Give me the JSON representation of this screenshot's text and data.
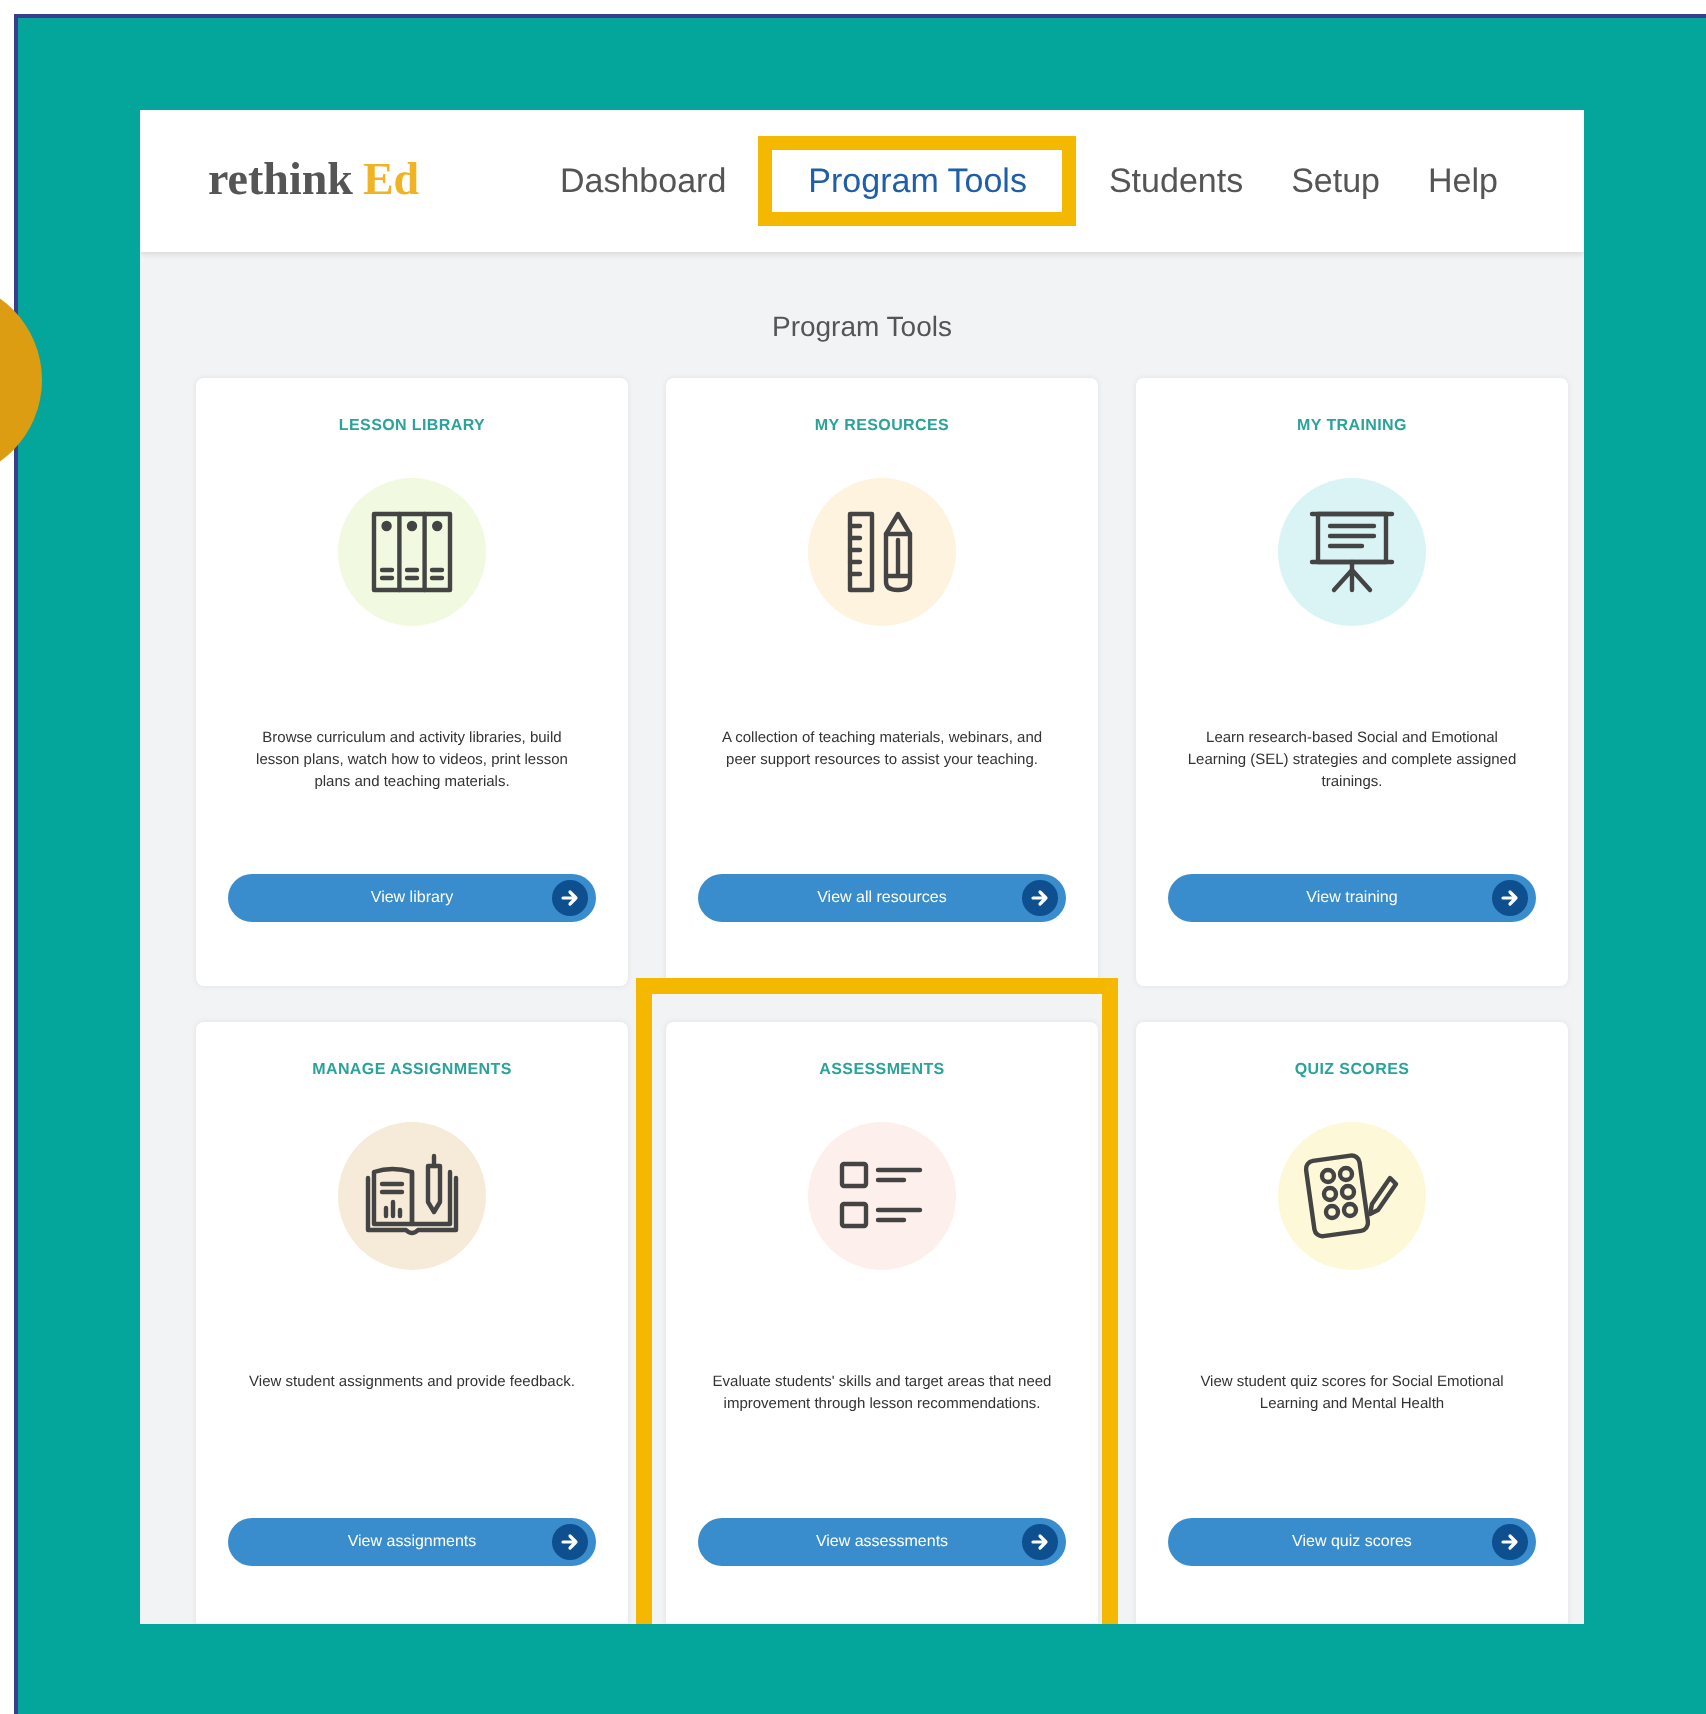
{
  "logo": {
    "part_1": "rethink",
    "part_2": "Ed"
  },
  "nav": [
    {
      "label": "Dashboard",
      "selected": false,
      "highlighted": false
    },
    {
      "label": "Program Tools",
      "selected": true,
      "highlighted": true
    },
    {
      "label": "Students",
      "selected": false,
      "highlighted": false
    },
    {
      "label": "Setup",
      "selected": false,
      "highlighted": false
    },
    {
      "label": "Help",
      "selected": false,
      "highlighted": false
    }
  ],
  "page_title": "Program Tools",
  "cards": [
    {
      "title": "LESSON LIBRARY",
      "color": "#f1f9e1",
      "description": "Browse curriculum and activity libraries, build lesson plans, watch how to videos, print lesson plans and teaching materials.",
      "button": "View library",
      "highlighted": false
    },
    {
      "title": "MY RESOURCES",
      "color": "#fef3df",
      "description": "A collection of teaching materials, webinars, and peer support resources to assist your teaching.",
      "button": "View all resources",
      "highlighted": false
    },
    {
      "title": "MY TRAINING",
      "color": "#daf4f5",
      "description": "Learn research-based Social and Emotional Learning (SEL) strategies and complete assigned trainings.",
      "button": "View training",
      "highlighted": false
    },
    {
      "title": "MANAGE ASSIGNMENTS",
      "color": "#f6ead8",
      "description": "View student assignments and provide feedback.",
      "button": "View assignments",
      "highlighted": false
    },
    {
      "title": "ASSESSMENTS",
      "color": "#fdf0ec",
      "description": "Evaluate students' skills and target areas that need improvement through lesson recommendations.",
      "button": "View assessments",
      "highlighted": true
    },
    {
      "title": "QUIZ SCORES",
      "color": "#fdf8d8",
      "description": "View student quiz scores for Social Emotional Learning and Mental Health",
      "button": "View quiz scores",
      "highlighted": false
    }
  ]
}
